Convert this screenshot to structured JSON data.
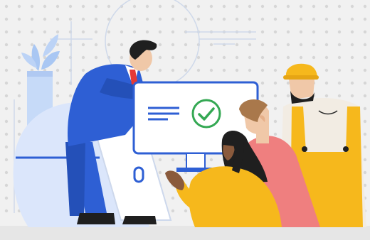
{
  "illustration": {
    "kind": "team-review-illustration",
    "monitor": {
      "status_icon": "check-circle-icon",
      "status": "approved"
    },
    "people": [
      "businessman-in-blue-suit",
      "woman-in-yellow-sweater",
      "man-in-pink-shirt",
      "construction-worker-in-hard-hat"
    ],
    "colors": {
      "background": "#f1f1f1",
      "dots": "#d6d6d6",
      "blue": "#2e5fd4",
      "light_blue": "#d4e2fb",
      "yellow": "#f6b81c",
      "pink": "#ef7f7f",
      "green_check": "#34a853",
      "dark_hair": "#1f1f1f",
      "skin": "#f0c8a8",
      "skin_dark": "#8a5a3c"
    }
  }
}
